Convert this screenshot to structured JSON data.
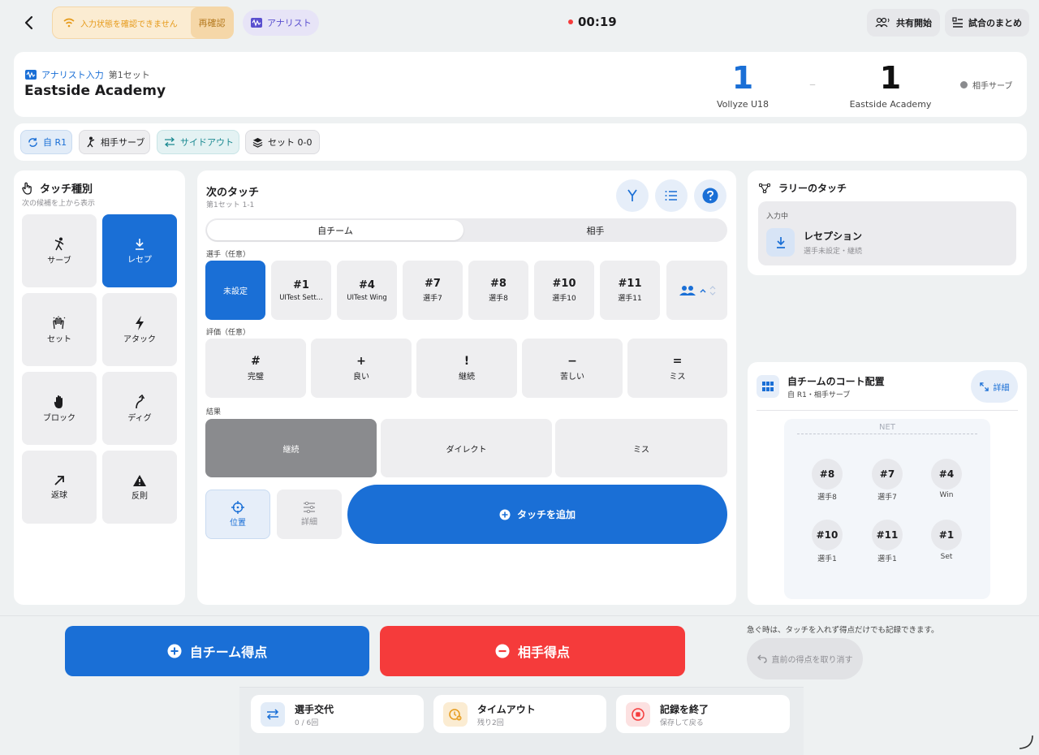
{
  "topbar": {
    "warning": "入力状態を確認できません",
    "recheck": "再確認",
    "analyst": "アナリスト",
    "timer": "00:19",
    "share": "共有開始",
    "summary": "試合のまとめ"
  },
  "header": {
    "mode": "アナリスト入力",
    "set": "第1セット",
    "team": "Eastside Academy",
    "score_home": "1",
    "score_sep": "–",
    "score_away": "1",
    "home_name": "Vollyze U18",
    "away_name": "Eastside Academy",
    "serve_status": "相手サーブ"
  },
  "status_chips": [
    "自 R1",
    "相手サーブ",
    "サイドアウト",
    "セット 0-0"
  ],
  "touch_types": {
    "title": "タッチ種別",
    "subtitle": "次の候補を上から表示",
    "items": [
      "サーブ",
      "レセプ",
      "セット",
      "アタック",
      "ブロック",
      "ディグ",
      "返球",
      "反則"
    ],
    "selected": "レセプ"
  },
  "next_touch": {
    "title": "次のタッチ",
    "subtitle": "第1セット 1-1",
    "tabs": [
      "自チーム",
      "相手"
    ],
    "active_tab": "自チーム",
    "player_label": "選手（任意）",
    "players": [
      {
        "num": "未設定",
        "name": ""
      },
      {
        "num": "#1",
        "name": "UITest Sett..."
      },
      {
        "num": "#4",
        "name": "UITest Wing"
      },
      {
        "num": "#7",
        "name": "選手7"
      },
      {
        "num": "#8",
        "name": "選手8"
      },
      {
        "num": "#10",
        "name": "選手10"
      },
      {
        "num": "#11",
        "name": "選手11"
      }
    ],
    "rating_label": "評価（任意）",
    "ratings": [
      {
        "sym": "#",
        "label": "完璧"
      },
      {
        "sym": "+",
        "label": "良い"
      },
      {
        "sym": "!",
        "label": "継続"
      },
      {
        "sym": "−",
        "label": "苦しい"
      },
      {
        "sym": "=",
        "label": "ミス"
      }
    ],
    "result_label": "結果",
    "results": [
      "継続",
      "ダイレクト",
      "ミス"
    ],
    "position": "位置",
    "detail": "詳細",
    "add_touch": "タッチを追加"
  },
  "rally": {
    "title": "ラリーのタッチ",
    "input_label": "入力中",
    "current": "レセプション",
    "current_sub": "選手未設定・継続"
  },
  "court": {
    "title": "自チームのコート配置",
    "subtitle": "自 R1・相手サーブ",
    "detail": "詳細",
    "net": "NET",
    "front": [
      {
        "num": "#8",
        "name": "選手8"
      },
      {
        "num": "#7",
        "name": "選手7"
      },
      {
        "num": "#4",
        "name": "Win"
      }
    ],
    "back": [
      {
        "num": "#10",
        "name": "選手1"
      },
      {
        "num": "#11",
        "name": "選手1"
      },
      {
        "num": "#1",
        "name": "Set"
      }
    ]
  },
  "bottom": {
    "home_point": "自チーム得点",
    "away_point": "相手得点",
    "hint": "急ぐ時は、タッチを入れず得点だけでも記録できます。",
    "undo": "直前の得点を取り消す",
    "sub_title": "選手交代",
    "sub_sub": "0 / 6回",
    "timeout_title": "タイムアウト",
    "timeout_sub": "残り2回",
    "end_title": "記録を終了",
    "end_sub": "保存して戻る"
  },
  "colors": {
    "primary": "#1a6fd6",
    "danger": "#f53b3b",
    "warning": "#e69a1a",
    "selected_result": "#8a8b8e"
  }
}
